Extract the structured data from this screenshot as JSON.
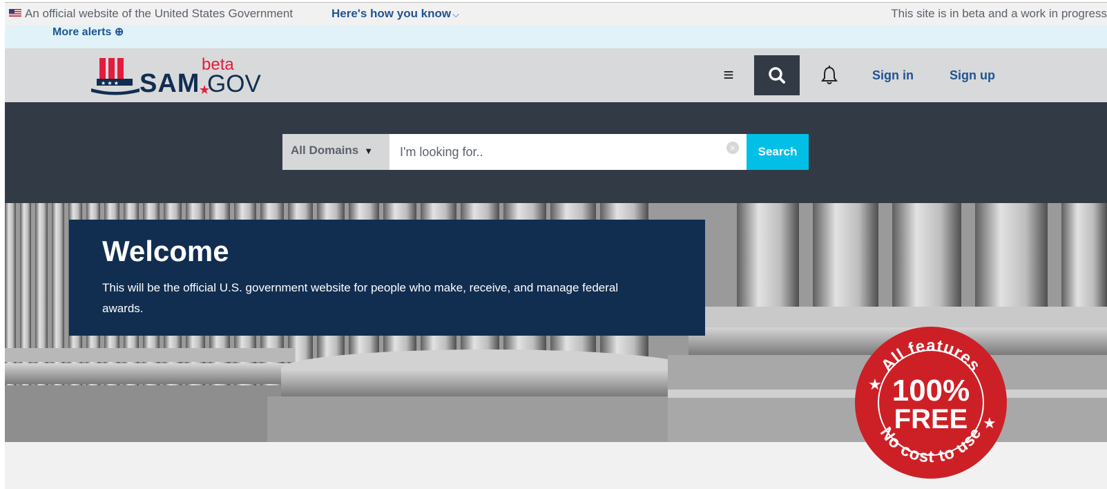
{
  "gov_banner": {
    "official_text": "An official website of the United States Government",
    "how_you_know": "Here's how you know",
    "beta_notice": "This site is in beta and a work in progress"
  },
  "alerts": {
    "more_alerts": "More alerts ⊕"
  },
  "header": {
    "logo_sam": "SAM",
    "logo_beta": "beta",
    "logo_gov": "GOV",
    "sign_in": "Sign in",
    "sign_up": "Sign up"
  },
  "search": {
    "domain_label": "All Domains",
    "placeholder": "I'm looking for..",
    "button_label": "Search"
  },
  "hero": {
    "title": "Welcome",
    "description": "This will be the official U.S. government website for people who make, receive, and manage federal awards."
  },
  "badge": {
    "top_text": "All features",
    "main_percent": "100%",
    "main_free": "FREE",
    "bottom_text": "No cost to use"
  },
  "colors": {
    "navy": "#112e51",
    "link_blue": "#205493",
    "search_cyan": "#02bfe7",
    "dark_band": "#323a45",
    "badge_red": "#cd2026"
  }
}
